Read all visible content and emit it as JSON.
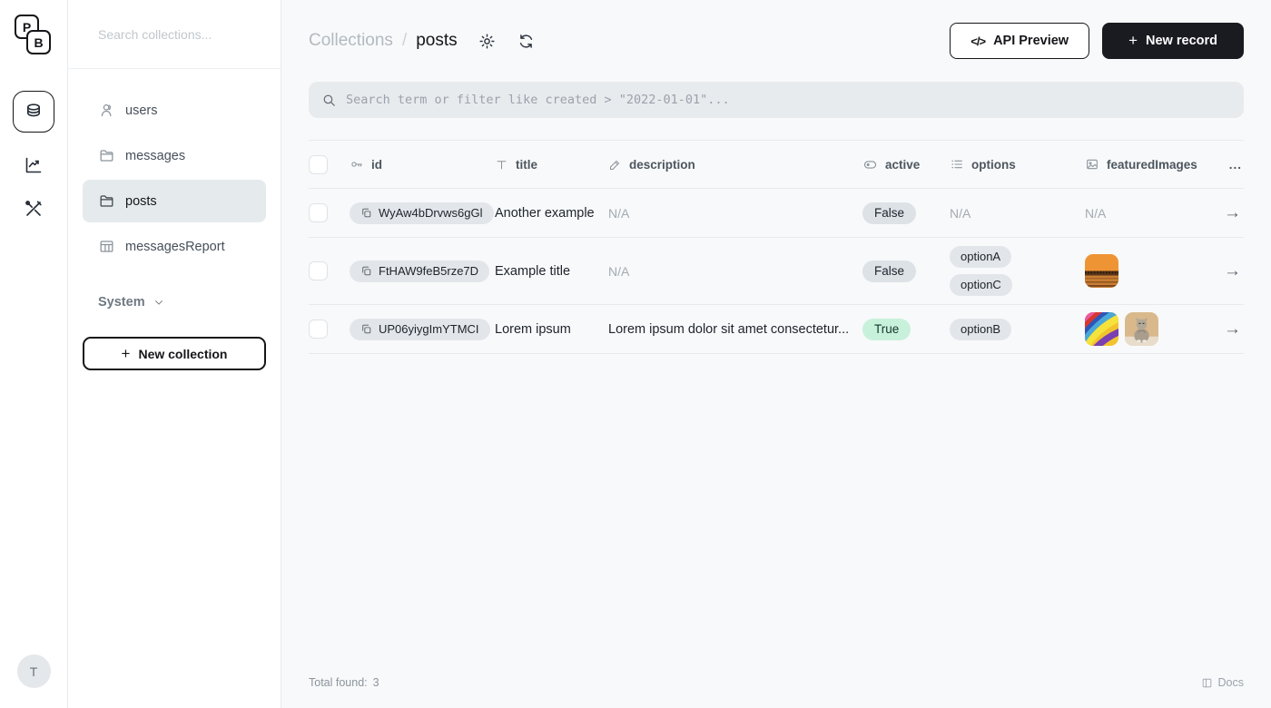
{
  "app": {
    "logo_p": "P",
    "logo_b": "B",
    "avatar_initial": "T"
  },
  "sidebar": {
    "search_placeholder": "Search collections...",
    "items": [
      {
        "label": "users"
      },
      {
        "label": "messages"
      },
      {
        "label": "posts"
      },
      {
        "label": "messagesReport"
      }
    ],
    "system_label": "System",
    "new_collection_label": "New collection"
  },
  "header": {
    "breadcrumb_root": "Collections",
    "breadcrumb_sep": "/",
    "breadcrumb_current": "posts",
    "api_preview_label": "API Preview",
    "new_record_label": "New record"
  },
  "filter": {
    "placeholder": "Search term or filter like created > \"2022-01-01\"..."
  },
  "table": {
    "columns": [
      {
        "label": "id"
      },
      {
        "label": "title"
      },
      {
        "label": "description"
      },
      {
        "label": "active"
      },
      {
        "label": "options"
      },
      {
        "label": "featuredImages"
      }
    ],
    "rows": [
      {
        "id": "WyAw4bDrvws6gGl",
        "title": "Another example",
        "description": "N/A",
        "active": "False",
        "options_na": "N/A",
        "images_na": "N/A"
      },
      {
        "id": "FtHAW9feB5rze7D",
        "title": "Example title",
        "description": "N/A",
        "active": "False",
        "options": [
          "optionA",
          "optionC"
        ]
      },
      {
        "id": "UP06yiygImYTMCI",
        "title": "Lorem ipsum",
        "description": "Lorem ipsum dolor sit amet consectetur...",
        "active": "True",
        "options": [
          "optionB"
        ]
      }
    ]
  },
  "footer": {
    "total_label": "Total found:",
    "total_value": "3",
    "docs_label": "Docs"
  },
  "icons": {
    "plus": "+",
    "code": "</>",
    "ellipsis": "...",
    "arrow": "→"
  },
  "colors": {
    "accent_dark": "#16161a",
    "page_bg": "#f8f9fa",
    "active_item_bg": "#e5eaed",
    "pill_bg": "#e2e6ea",
    "badge_true_bg": "#c8f1dc",
    "badge_false_bg": "#dde2e7"
  }
}
